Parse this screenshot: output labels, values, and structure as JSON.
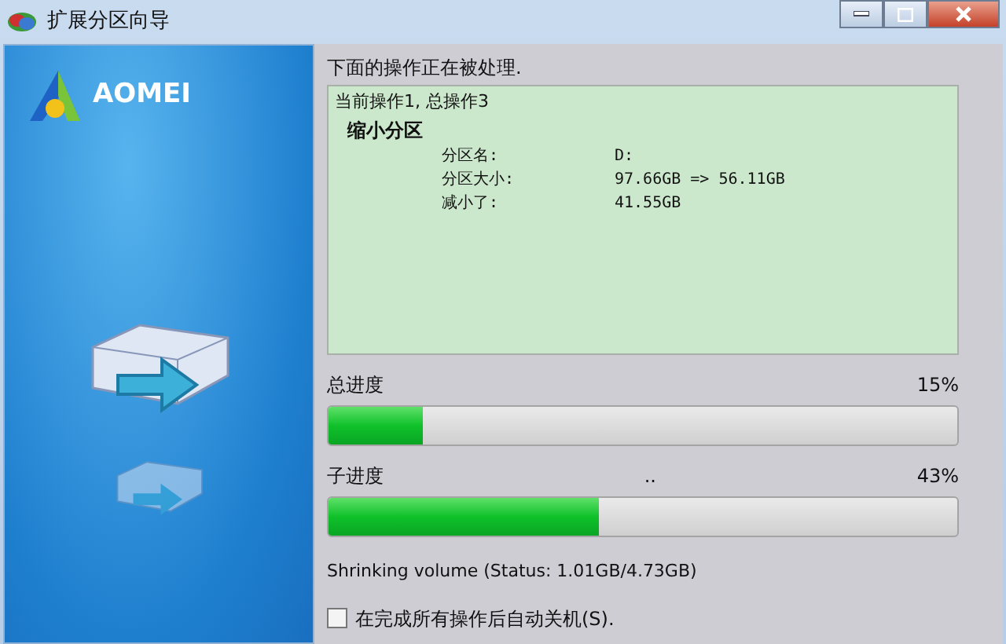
{
  "window": {
    "title": "扩展分区向导"
  },
  "sidebar": {
    "logo_text": "AOMEI"
  },
  "heading": "下面的操作正在被处理.",
  "details": {
    "summary": "当前操作1, 总操作3",
    "operation": "缩小分区",
    "fields": [
      {
        "label": "分区名:",
        "value": "D:"
      },
      {
        "label": "分区大小:",
        "value": "97.66GB => 56.11GB"
      },
      {
        "label": "减小了:",
        "value": "41.55GB"
      }
    ]
  },
  "progress": [
    {
      "label": "总进度",
      "percent": "15%",
      "level": 0.15
    },
    {
      "label": "子进度",
      "note": "..",
      "percent": "43%",
      "level": 0.43
    }
  ],
  "status_text": "Shrinking volume (Status: 1.01GB/4.73GB)",
  "options": [
    {
      "label": "在完成所有操作后自动关机(S).",
      "checked": false
    }
  ]
}
